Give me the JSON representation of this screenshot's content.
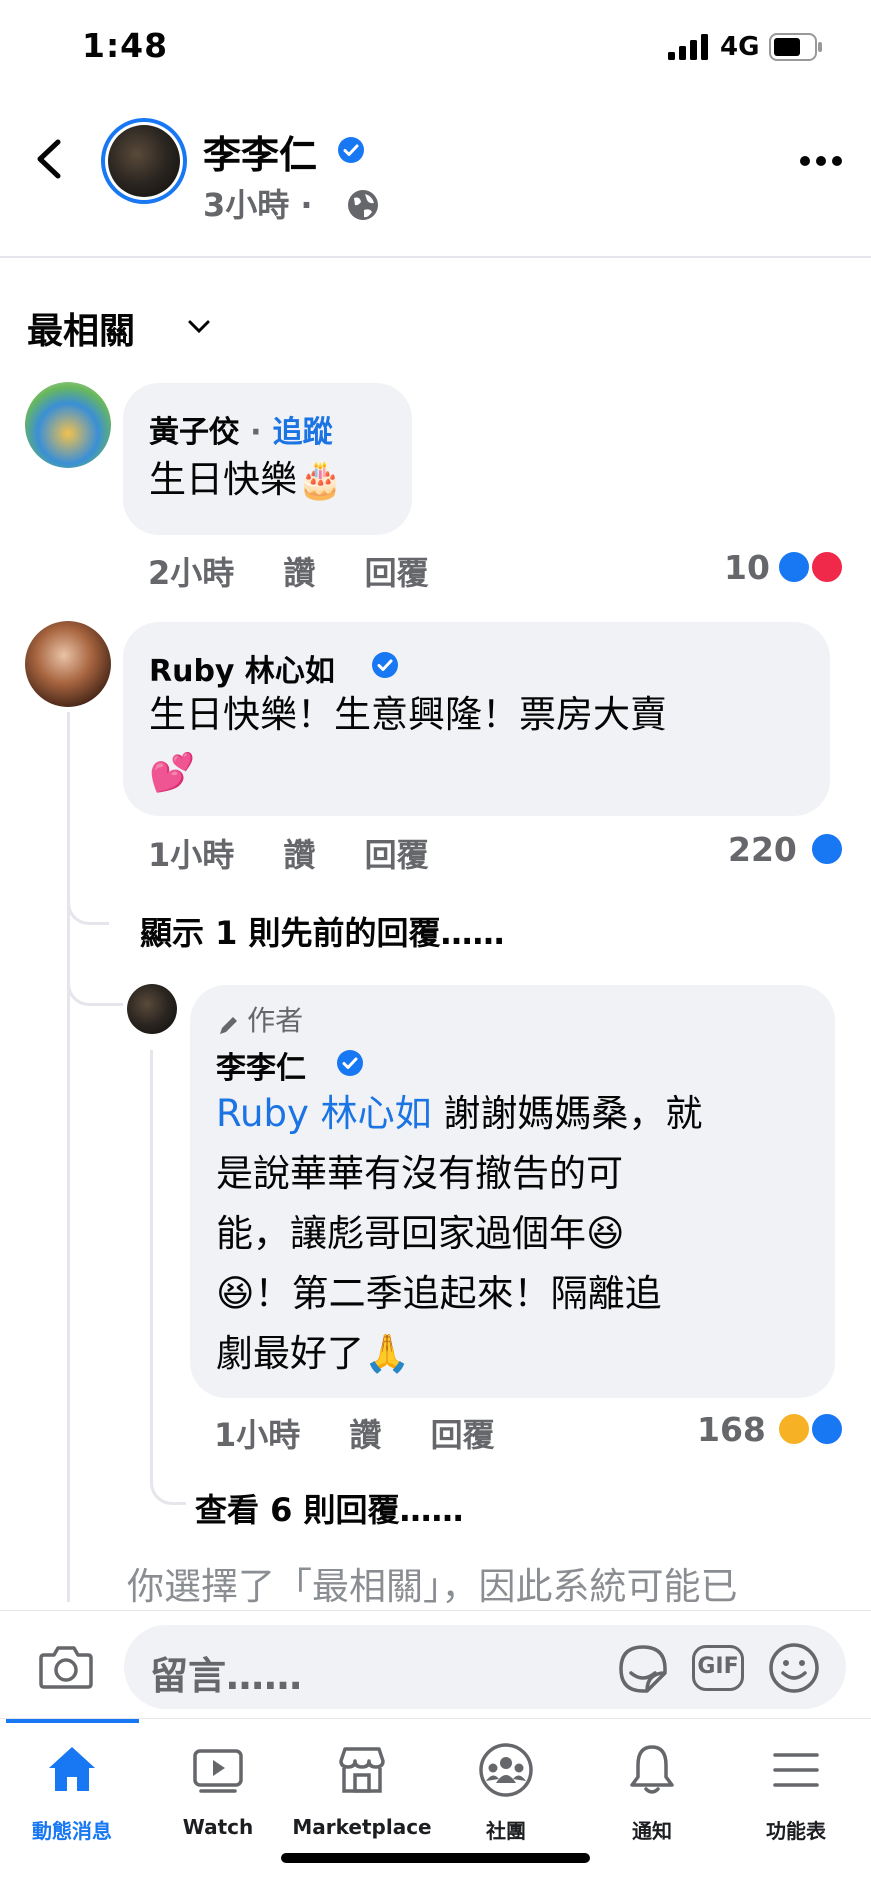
{
  "status_bar": {
    "time": "1:48",
    "network": "4G"
  },
  "header": {
    "name": "李李仁",
    "time": "3小時",
    "separator": "·"
  },
  "sort": {
    "label": "最相關"
  },
  "comments": [
    {
      "name": "黃子佼",
      "dot": "·",
      "follow": "追蹤",
      "text": "生日快樂🎂",
      "time": "2小時",
      "like": "讚",
      "reply": "回覆",
      "count": "10"
    },
    {
      "name": "Ruby 林心如",
      "text": "生日快樂！生意興隆！票房大賣",
      "text2": "💕",
      "time": "1小時",
      "like": "讚",
      "reply": "回覆",
      "count": "220"
    }
  ],
  "previous_replies": "顯示 1 則先前的回覆……",
  "reply": {
    "author_tag": "作者",
    "name": "李李仁",
    "mention": "Ruby 林心如",
    "line1": " 謝謝媽媽桑，就",
    "line2": "是說華華有沒有撤告的可",
    "line3": "能，讓彪哥回家過個年😆",
    "line4": "😆！第二季追起來！隔離追",
    "line5": "劇最好了🙏",
    "time": "1小時",
    "like": "讚",
    "reply": "回覆",
    "count": "168"
  },
  "view_replies": "查看 6 則回覆……",
  "notice": "你選擇了「最相關」，因此系統可能已",
  "composer": {
    "placeholder": "留言……",
    "gif": "GIF"
  },
  "tabs": [
    {
      "label": "動態消息",
      "icon": "home-icon"
    },
    {
      "label": "Watch",
      "icon": "watch-icon"
    },
    {
      "label": "Marketplace",
      "icon": "marketplace-icon"
    },
    {
      "label": "社團",
      "icon": "groups-icon"
    },
    {
      "label": "通知",
      "icon": "bell-icon"
    },
    {
      "label": "功能表",
      "icon": "menu-icon"
    }
  ],
  "colors": {
    "accent": "#1877f2",
    "bubble": "#f0f2f5",
    "secondary_text": "#65676b"
  }
}
